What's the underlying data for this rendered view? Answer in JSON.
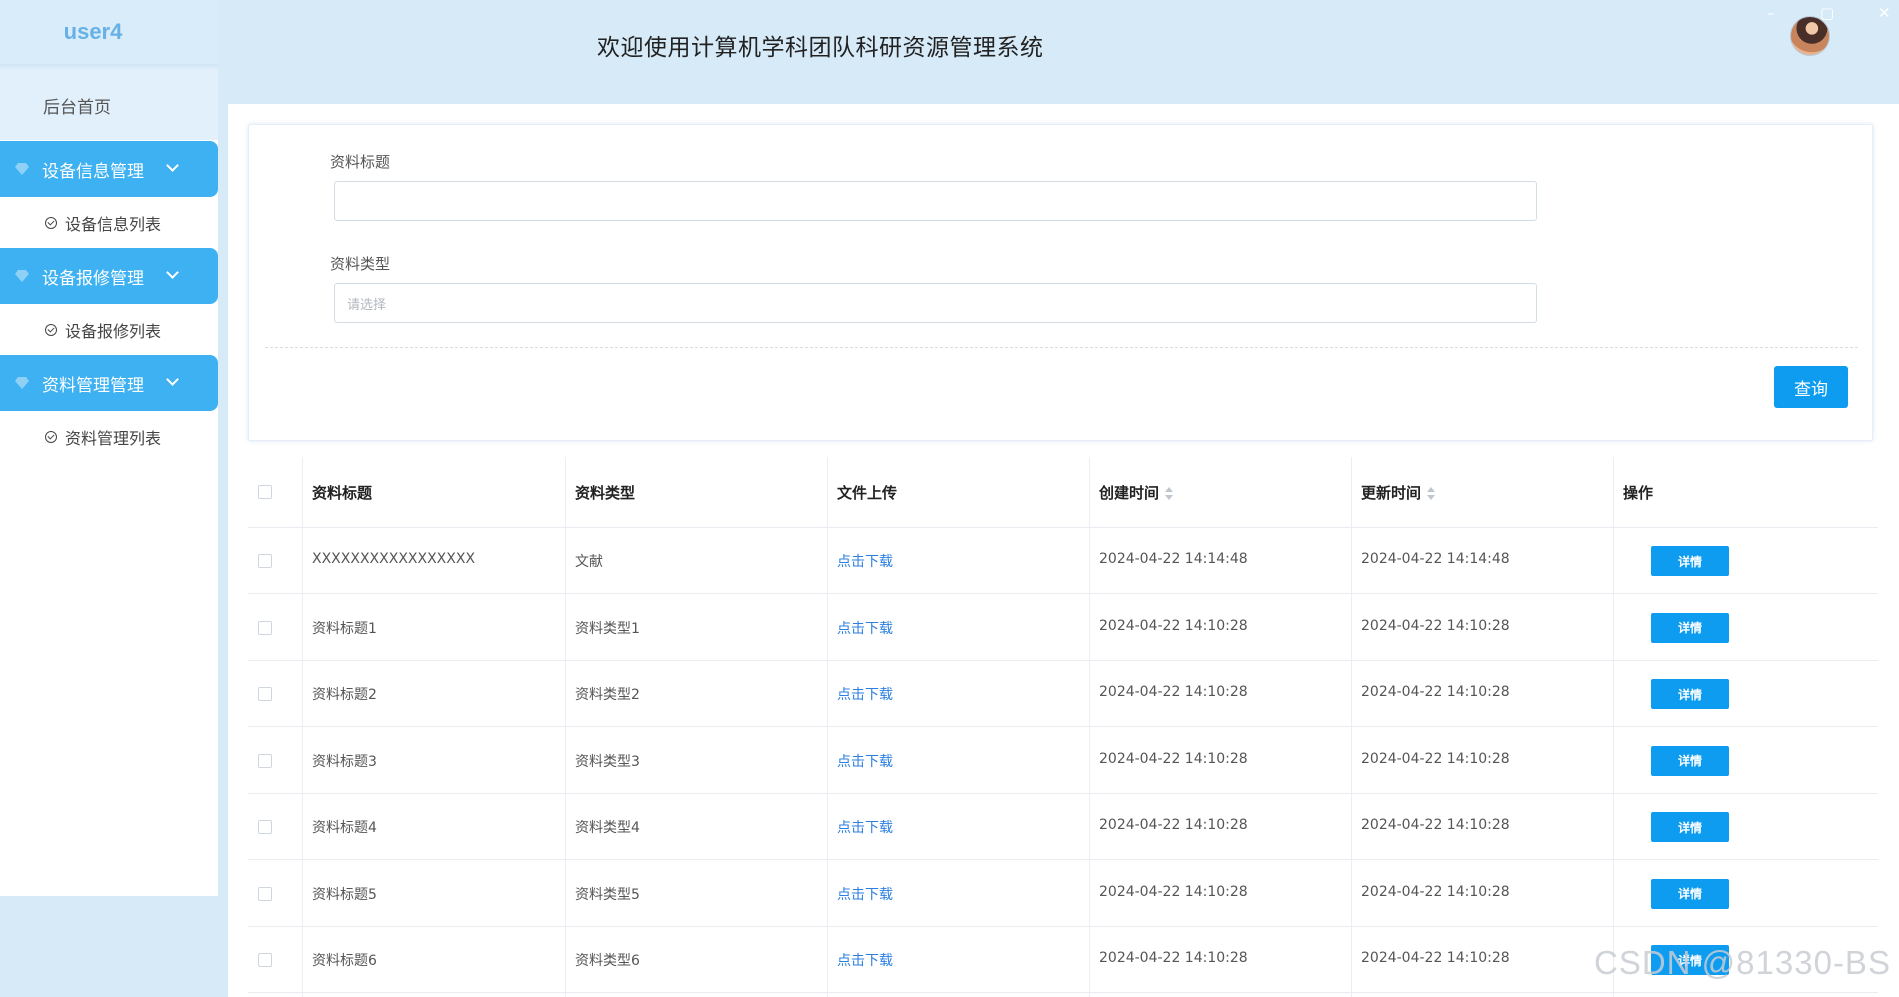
{
  "header": {
    "brand": "user4",
    "title": "欢迎使用计算机学科团队科研资源管理系统",
    "window_controls": [
      "–",
      "▢",
      "✕"
    ]
  },
  "sidebar": {
    "home": "后台首页",
    "groups": [
      {
        "label": "设备信息管理",
        "sub": "设备信息列表"
      },
      {
        "label": "设备报修管理",
        "sub": "设备报修列表"
      },
      {
        "label": "资料管理管理",
        "sub": "资料管理列表"
      }
    ]
  },
  "search": {
    "title_label": "资料标题",
    "title_value": "",
    "type_label": "资料类型",
    "type_placeholder": "请选择",
    "query_button": "查询"
  },
  "table": {
    "headers": [
      "资料标题",
      "资料类型",
      "文件上传",
      "创建时间",
      "更新时间",
      "操作"
    ],
    "rows": [
      {
        "title": "XXXXXXXXXXXXXXXXX",
        "type": "文献",
        "file": "点击下载",
        "created": "2024-04-22 14:14:48",
        "updated": "2024-04-22 14:14:48",
        "action": "详情"
      },
      {
        "title": "资料标题1",
        "type": "资料类型1",
        "file": "点击下载",
        "created": "2024-04-22 14:10:28",
        "updated": "2024-04-22 14:10:28",
        "action": "详情"
      },
      {
        "title": "资料标题2",
        "type": "资料类型2",
        "file": "点击下载",
        "created": "2024-04-22 14:10:28",
        "updated": "2024-04-22 14:10:28",
        "action": "详情"
      },
      {
        "title": "资料标题3",
        "type": "资料类型3",
        "file": "点击下载",
        "created": "2024-04-22 14:10:28",
        "updated": "2024-04-22 14:10:28",
        "action": "详情"
      },
      {
        "title": "资料标题4",
        "type": "资料类型4",
        "file": "点击下载",
        "created": "2024-04-22 14:10:28",
        "updated": "2024-04-22 14:10:28",
        "action": "详情"
      },
      {
        "title": "资料标题5",
        "type": "资料类型5",
        "file": "点击下载",
        "created": "2024-04-22 14:10:28",
        "updated": "2024-04-22 14:10:28",
        "action": "详情"
      },
      {
        "title": "资料标题6",
        "type": "资料类型6",
        "file": "点击下载",
        "created": "2024-04-22 14:10:28",
        "updated": "2024-04-22 14:10:28",
        "action": "详情"
      }
    ]
  },
  "watermark": "CSDN @81330-BS",
  "colors": {
    "accent": "#0d9cf0",
    "menu": "#3eb1f2",
    "header_bg": "#d6eaf8",
    "link": "#2b7fe0"
  }
}
